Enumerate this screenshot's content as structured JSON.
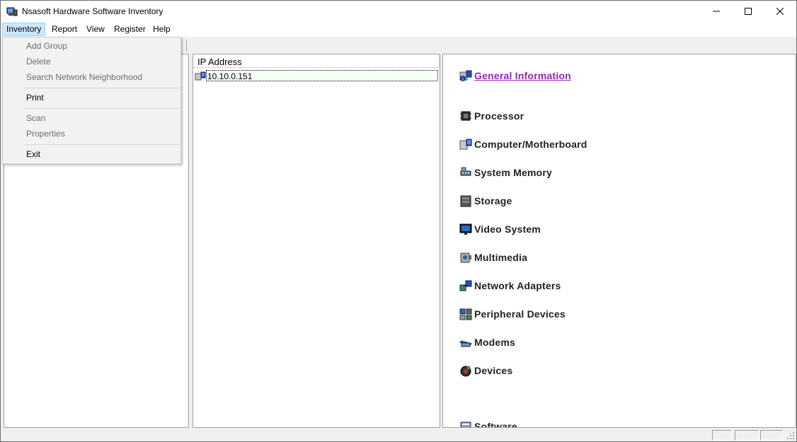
{
  "window": {
    "title": "Nsasoft Hardware Software Inventory"
  },
  "menubar": {
    "items": [
      {
        "label": "Inventory"
      },
      {
        "label": "Report"
      },
      {
        "label": "View"
      },
      {
        "label": "Register"
      },
      {
        "label": "Help"
      }
    ]
  },
  "inventory_menu": {
    "items": [
      {
        "label": "Add Group",
        "enabled": false
      },
      {
        "label": "Delete",
        "enabled": false
      },
      {
        "label": "Search Network Neighborhood",
        "enabled": false
      },
      {
        "label": "Print",
        "enabled": true
      },
      {
        "label": "Scan",
        "enabled": false
      },
      {
        "label": "Properties",
        "enabled": false
      },
      {
        "label": "Exit",
        "enabled": true
      }
    ]
  },
  "hosts": {
    "column_header": "IP Address",
    "rows": [
      "10.10.0.151"
    ]
  },
  "categories": [
    {
      "label": "General Information",
      "icon": "general-information-icon"
    },
    {
      "label": "Processor",
      "icon": "processor-icon"
    },
    {
      "label": "Computer/Motherboard",
      "icon": "motherboard-icon"
    },
    {
      "label": "System Memory",
      "icon": "memory-icon"
    },
    {
      "label": "Storage",
      "icon": "storage-icon"
    },
    {
      "label": "Video System",
      "icon": "video-icon"
    },
    {
      "label": "Multimedia",
      "icon": "multimedia-icon"
    },
    {
      "label": "Network Adapters",
      "icon": "network-icon"
    },
    {
      "label": "Peripheral Devices",
      "icon": "peripheral-icon"
    },
    {
      "label": "Modems",
      "icon": "modem-icon"
    },
    {
      "label": "Devices",
      "icon": "devices-icon"
    },
    {
      "label": "Software",
      "icon": "software-icon"
    }
  ],
  "colors": {
    "link": "#a020c0",
    "menu_active": "#cce8ff"
  }
}
